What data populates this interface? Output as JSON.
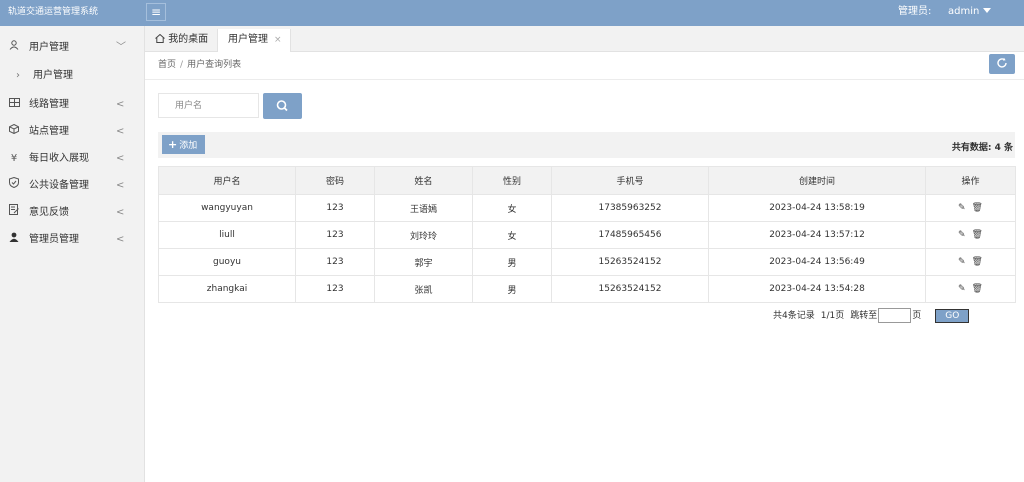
{
  "header": {
    "brand": "轨道交通运营管理系统",
    "admin_label": "管理员:",
    "admin_user": "admin"
  },
  "sidebar": {
    "items": [
      {
        "label": "用户管理",
        "icon": "user-icon",
        "arrow": "﹀"
      },
      {
        "label": "线路管理",
        "icon": "route-icon",
        "arrow": "<"
      },
      {
        "label": "站点管理",
        "icon": "station-icon",
        "arrow": "<"
      },
      {
        "label": "每日收入展现",
        "icon": "yen-icon",
        "arrow": "<"
      },
      {
        "label": "公共设备管理",
        "icon": "shield-icon",
        "arrow": "<"
      },
      {
        "label": "意见反馈",
        "icon": "feedback-icon",
        "arrow": "<"
      },
      {
        "label": "管理员管理",
        "icon": "admin-icon",
        "arrow": "<"
      }
    ],
    "sub_items": [
      {
        "label": "用户管理"
      }
    ]
  },
  "tabs": [
    {
      "label": "我的桌面"
    },
    {
      "label": "用户管理",
      "close": "×"
    }
  ],
  "breadcrumb": {
    "home": "首页",
    "sep": "/",
    "current": "用户查询列表"
  },
  "search": {
    "placeholder": "用户名"
  },
  "toolbar": {
    "add_label": "添加",
    "total_text": "共有数据: 4 条"
  },
  "table": {
    "headers": [
      "用户名",
      "密码",
      "姓名",
      "性别",
      "手机号",
      "创建时间",
      "操作"
    ],
    "rows": [
      [
        "wangyuyan",
        "123",
        "王语嫣",
        "女",
        "17385963252",
        "2023-04-24 13:58:19"
      ],
      [
        "liull",
        "123",
        "刘玲玲",
        "女",
        "17485965456",
        "2023-04-24 13:57:12"
      ],
      [
        "guoyu",
        "123",
        "郭宇",
        "男",
        "15263524152",
        "2023-04-24 13:56:49"
      ],
      [
        "zhangkai",
        "123",
        "张凯",
        "男",
        "15263524152",
        "2023-04-24 13:54:28"
      ]
    ]
  },
  "pager": {
    "records": "共4条记录",
    "pages": "1/1页",
    "jump_label": "跳转至",
    "page_suffix": "页",
    "go_label": "GO"
  },
  "colors": {
    "accent": "#7ea1c8"
  }
}
